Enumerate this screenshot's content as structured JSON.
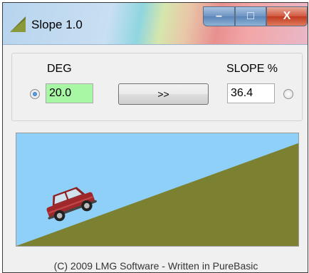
{
  "window": {
    "title": "Slope 1.0"
  },
  "titlebar_buttons": {
    "minimize_glyph": "–",
    "maximize_glyph": "□",
    "close_glyph": "X"
  },
  "panel": {
    "deg_label": "DEG",
    "deg_value": "20.0",
    "deg_selected": true,
    "convert_label": ">>",
    "slope_label": "SLOPE %",
    "slope_value": "36.4",
    "slope_selected": false
  },
  "scene": {
    "angle_deg": 20.0,
    "sky_color": "#8fd0f8",
    "ground_color": "#7c8031",
    "car_color": "#a0282a"
  },
  "footer": {
    "text": "(C) 2009 LMG Software - Written in PureBasic"
  }
}
